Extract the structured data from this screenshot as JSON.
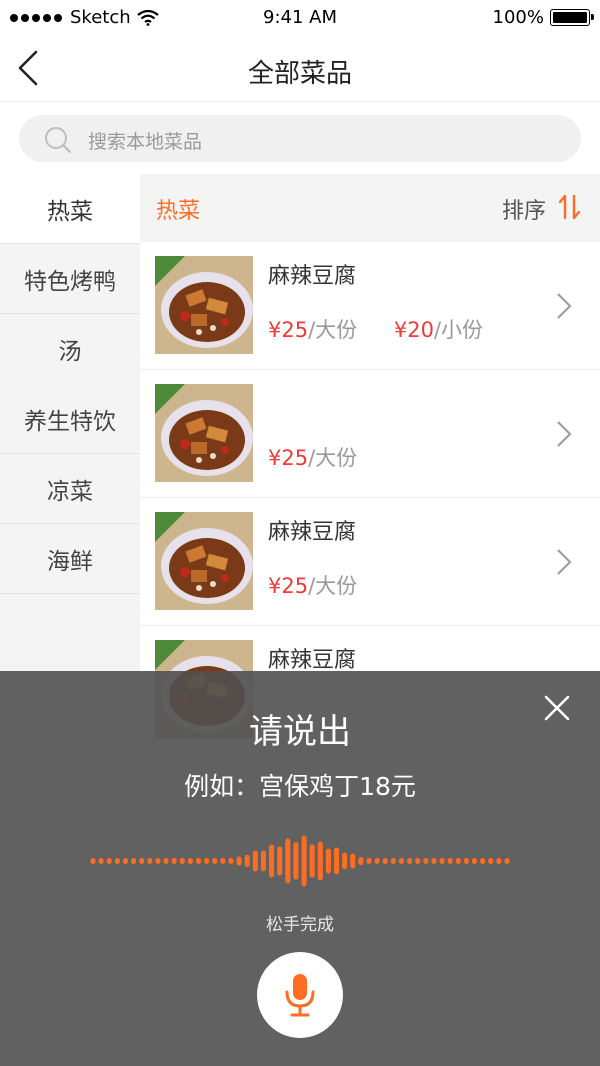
{
  "status": {
    "carrier": "Sketch",
    "time": "9:41 AM",
    "battery": "100%"
  },
  "nav": {
    "title": "全部菜品"
  },
  "search": {
    "placeholder": "搜索本地菜品"
  },
  "sidebar": {
    "items": [
      {
        "label": "热菜",
        "active": true
      },
      {
        "label": "特色烤鸭"
      },
      {
        "label": "汤"
      },
      {
        "label": "养生特饮"
      },
      {
        "label": "凉菜"
      },
      {
        "label": "海鲜"
      }
    ]
  },
  "content": {
    "category_title": "热菜",
    "sort_label": "排序",
    "dishes": [
      {
        "name": "麻辣豆腐",
        "price1": "¥25",
        "unit1": "/大份",
        "price2": "¥20",
        "unit2": "/小份"
      },
      {
        "name": "",
        "price1": "¥25",
        "unit1": "/大份"
      },
      {
        "name": "麻辣豆腐",
        "price1": "¥25",
        "unit1": "/大份"
      },
      {
        "name": "麻辣豆腐"
      }
    ]
  },
  "voice": {
    "title": "请说出",
    "example": "例如：宫保鸡丁18元",
    "release_hint": "松手完成"
  },
  "colors": {
    "accent": "#ff6d22",
    "price": "#f03a3a"
  }
}
